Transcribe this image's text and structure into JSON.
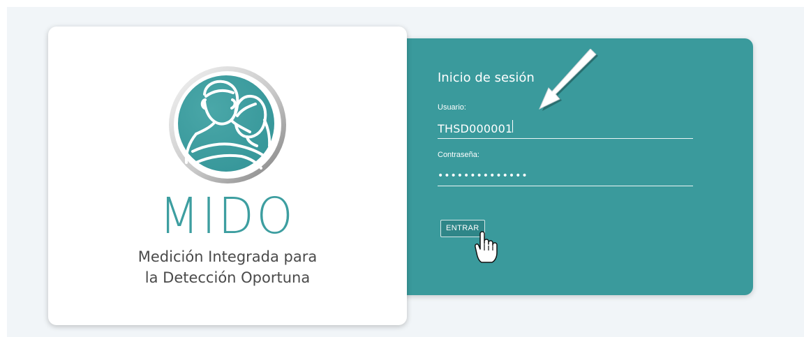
{
  "brand": {
    "name": "MIDO",
    "tagline_lines": [
      "Medición Integrada para",
      "la Detección Oportuna"
    ]
  },
  "login": {
    "title": "Inicio de sesión",
    "username_label": "Usuario:",
    "username_value": "THSD000001",
    "password_label": "Contraseña:",
    "password_value": "••••••••••••••",
    "submit_label": "ENTRAR"
  },
  "colors": {
    "accent": "#3a9a9c",
    "logo_teal": "#3d9ea0",
    "page_bg": "#f1f5f8"
  },
  "icons": {
    "logo": "family-logo-icon",
    "annotation_arrow": "arrow-pointer-icon",
    "cursor": "hand-cursor-icon"
  }
}
